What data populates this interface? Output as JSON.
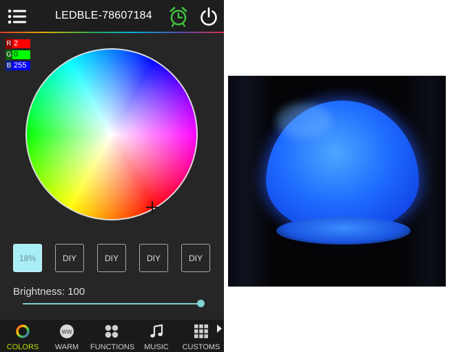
{
  "header": {
    "title": "LEDBLE-78607184",
    "icons": [
      "menu-icon",
      "alarm-clock-icon",
      "power-icon"
    ],
    "alarm_color": "#3fbf3f"
  },
  "rgb": {
    "r_label": "R",
    "r_value": "2",
    "g_label": "G",
    "g_value": "0",
    "b_label": "B",
    "b_value": "255"
  },
  "presets": [
    {
      "label": "18%",
      "selected": true
    },
    {
      "label": "DIY",
      "selected": false
    },
    {
      "label": "DIY",
      "selected": false
    },
    {
      "label": "DIY",
      "selected": false
    },
    {
      "label": "DIY",
      "selected": false
    }
  ],
  "brightness": {
    "label": "Brightness: 100",
    "value": 100,
    "min": 0,
    "max": 100,
    "accent": "#7fd3d0"
  },
  "nav": {
    "items": [
      {
        "label": "COLORS",
        "icon": "color-ring-icon",
        "active": true
      },
      {
        "label": "WARM",
        "icon": "ww-icon",
        "active": false
      },
      {
        "label": "FUNCTIONS",
        "icon": "four-dots-icon",
        "active": false
      },
      {
        "label": "MUSIC",
        "icon": "music-note-icon",
        "active": false
      },
      {
        "label": "CUSTOMS",
        "icon": "grid-icon",
        "active": false
      }
    ],
    "active_color": "#b7df00",
    "more_icon": "chevron-right-icon"
  },
  "photo": {
    "subject": "bulb-photo",
    "color": "#1f6dff"
  }
}
